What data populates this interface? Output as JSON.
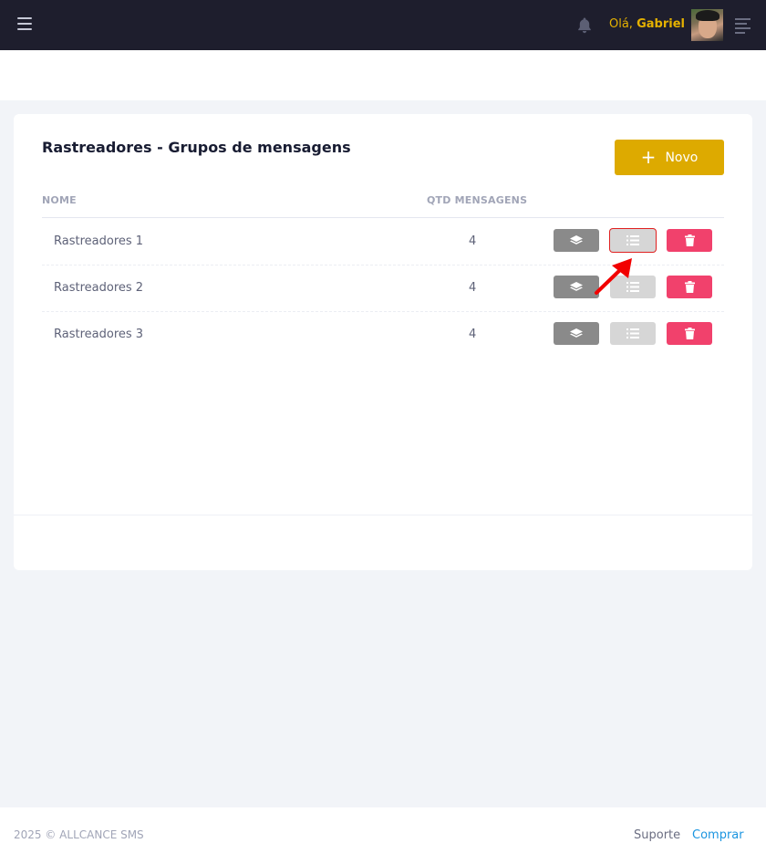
{
  "header": {
    "greeting": "Olá,",
    "user_name": "Gabriel",
    "icons": [
      "hamburger-icon",
      "bell-icon",
      "avatar",
      "menu-icon"
    ],
    "colors": {
      "topbar": "#1e1e2d",
      "accent": "#ddaa00"
    }
  },
  "card": {
    "title": "Rastreadores - Grupos de mensagens",
    "new_button_label": "Novo",
    "new_button_icon": "plus-icon",
    "columns": [
      "NOME",
      "QTD MENSAGENS"
    ],
    "rows": [
      {
        "nome": "Rastreadores 1",
        "qtd": "4"
      },
      {
        "nome": "Rastreadores 2",
        "qtd": "4"
      },
      {
        "nome": "Rastreadores 3",
        "qtd": "4"
      }
    ],
    "action_icons": [
      "layers-icon",
      "list-icon",
      "trash-icon"
    ],
    "action_colors": {
      "layers": "#8a8a8a",
      "list": "#d6d6d6",
      "delete": "#f1416c"
    }
  },
  "footer": {
    "copyright": "2025 © ALLCANCE SMS",
    "links": [
      "Suporte",
      "Comprar"
    ]
  }
}
